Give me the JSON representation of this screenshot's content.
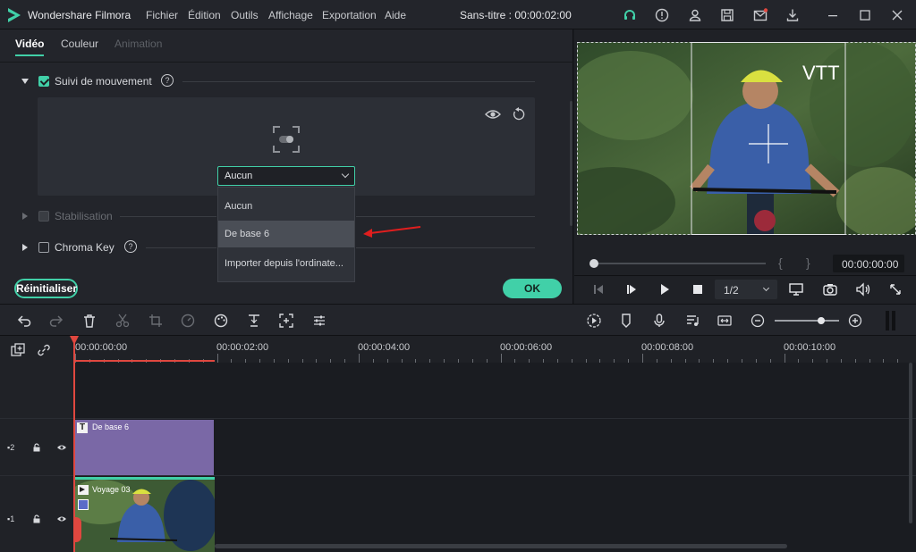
{
  "app": {
    "name": "Wondershare Filmora",
    "document_title": "Sans-titre : 00:00:02:00"
  },
  "menu": [
    "Fichier",
    "Édition",
    "Outils",
    "Affichage",
    "Exportation",
    "Aide"
  ],
  "titlebar_icons": [
    "headset-icon",
    "info-icon",
    "user-icon",
    "save-icon",
    "mail-icon",
    "download-icon",
    "minimize-icon",
    "maximize-icon",
    "close-icon"
  ],
  "props": {
    "tabs": [
      "Vidéo",
      "Couleur",
      "Animation"
    ],
    "active_tab": "Vidéo",
    "sections": {
      "motion_tracking": {
        "label": "Suivi de mouvement",
        "checked": true,
        "expanded": true
      },
      "stabilization": {
        "label": "Stabilisation",
        "checked": false,
        "enabled": false
      },
      "chroma_key": {
        "label": "Chroma Key",
        "checked": false
      }
    },
    "help_glyph": "?",
    "dropdown": {
      "value": "Aucun",
      "options": [
        "Aucun",
        "De base 6",
        "Importer depuis l'ordinate..."
      ],
      "highlighted": "De base 6"
    },
    "reset_label": "Réinitialiser",
    "ok_label": "OK"
  },
  "preview": {
    "overlay_text": "VTT",
    "timecode": "00:00:00:00",
    "bracket_left": "{",
    "bracket_right": "}",
    "quality": "1/2",
    "progress": 0.0
  },
  "timeline": {
    "ruler_labels": [
      "00:00:00:00",
      "00:00:02:00",
      "00:00:04:00",
      "00:00:06:00",
      "00:00:08:00",
      "00:00:10:00"
    ],
    "tracks": [
      {
        "id": "2",
        "clip_label": "De base 6",
        "clip_type": "title"
      },
      {
        "id": "1",
        "clip_label": "Voyage 03",
        "clip_type": "video"
      }
    ]
  },
  "colors": {
    "accent": "#41d0a8",
    "title_clip": "#7a68a6",
    "playhead": "#e0473f",
    "annotation_arrow": "#e01e1e"
  }
}
